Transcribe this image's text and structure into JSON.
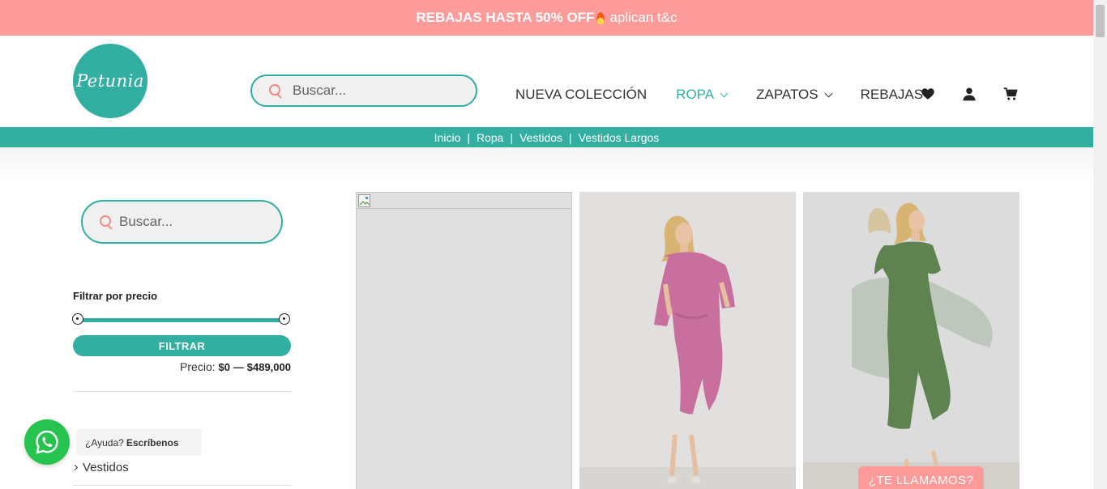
{
  "promo": {
    "strong": "REBAJAS HASTA 50% OFF",
    "light": "aplican t&c"
  },
  "logo": {
    "text": "Petunia"
  },
  "search": {
    "placeholder": "Buscar..."
  },
  "nav": {
    "items": [
      {
        "label": "NUEVA COLECCIÓN"
      },
      {
        "label": "ROPA",
        "active": true
      },
      {
        "label": "ZAPATOS"
      },
      {
        "label": "REBAJAS"
      }
    ]
  },
  "icons": {
    "wishlist": "heart-icon",
    "account": "user-icon",
    "cart": "cart-icon"
  },
  "breadcrumb": [
    "Inicio",
    "Ropa",
    "Vestidos",
    "Vestidos Largos"
  ],
  "sidebar": {
    "search_placeholder": "Buscar...",
    "filter_title": "Filtrar por precio",
    "filter_button": "FILTRAR",
    "price_label": "Precio:",
    "price_min": "$0",
    "price_dash": "—",
    "price_max": "$489,000",
    "category_item": "Vestidos"
  },
  "whatsapp": {
    "question": "¿Ayuda?",
    "action": "Escríbenos"
  },
  "call_button": "¿TE LLAMAMOS?",
  "colors": {
    "accent": "#33afa2",
    "promo": "#fd9b9b",
    "whatsapp": "#27c34f"
  }
}
